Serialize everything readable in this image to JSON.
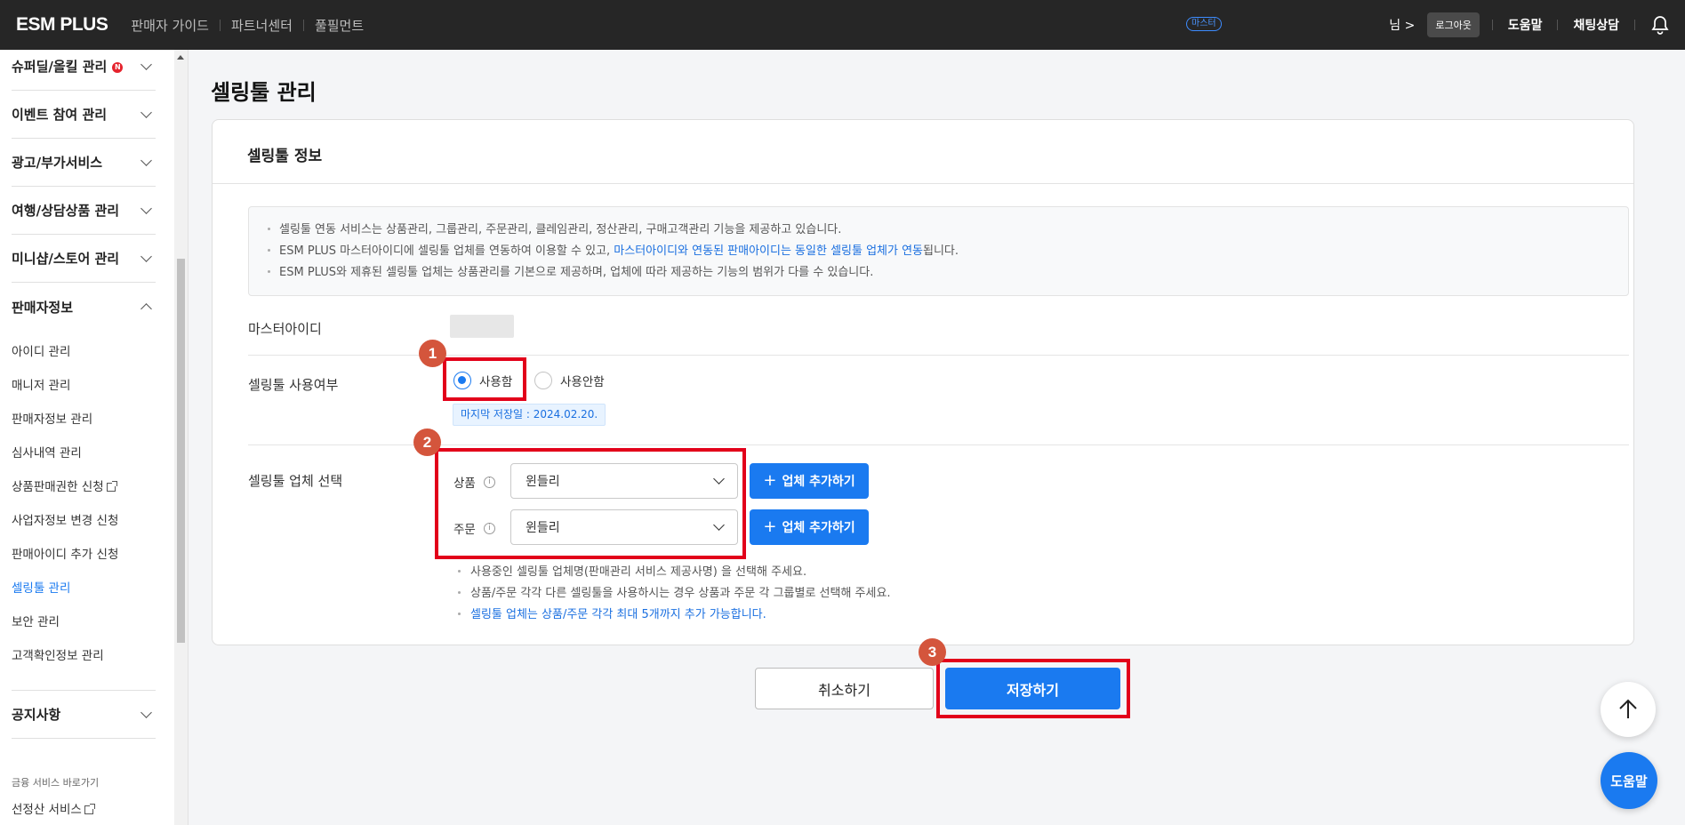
{
  "header": {
    "logo": "ESM PLUS",
    "nav": [
      "판매자 가이드",
      "파트너센터",
      "풀필먼트"
    ],
    "master_badge": "마스터",
    "user": "님 >",
    "logout": "로그아웃",
    "help": "도움말",
    "chat": "채팅상담",
    "bell_icon": "bell-icon"
  },
  "sidebar": {
    "groups_top": [
      {
        "label": "슈퍼딜/올킬 관리",
        "badge": "N"
      },
      {
        "label": "이벤트 참여 관리"
      },
      {
        "label": "광고/부가서비스"
      },
      {
        "label": "여행/상담상품 관리"
      },
      {
        "label": "미니샵/스토어 관리"
      }
    ],
    "open_group": "판매자정보",
    "items": [
      {
        "label": "아이디 관리"
      },
      {
        "label": "매니저 관리"
      },
      {
        "label": "판매자정보 관리"
      },
      {
        "label": "심사내역 관리"
      },
      {
        "label": "상품판매권한 신청"
      },
      {
        "label": "사업자정보 변경 신청"
      },
      {
        "label": "판매아이디 추가 신청"
      },
      {
        "label": "셀링툴 관리"
      },
      {
        "label": "보안 관리"
      },
      {
        "label": "고객확인정보 관리"
      }
    ],
    "notice_group": "공지사항",
    "finance_label": "금융 서비스 바로가기",
    "finance_item": "선정산 서비스"
  },
  "main": {
    "page_title": "셀링툴 관리",
    "card_title": "셀링툴 정보",
    "info": {
      "line1": "셀링툴 연동 서비스는 상품관리, 그룹관리, 주문관리, 클레임관리, 정산관리, 구매고객관리 기능을 제공하고 있습니다.",
      "line2_a": "ESM PLUS 마스터아이디에 셀링툴 업체를 연동하여 이용할 수 있고, ",
      "line2_b": "마스터아이디와 연동된 판매아이디는 동일한 셀링툴 업체가 연동",
      "line2_c": "됩니다.",
      "line3": "ESM PLUS와 제휴된 셀링툴 업체는 상품관리를 기본으로 제공하며, 업체에 따라 제공하는 기능의 범위가 다를 수 있습니다."
    },
    "master_id_label": "마스터아이디",
    "usage_label": "셀링툴 사용여부",
    "radio_use": "사용함",
    "radio_nouse": "사용안함",
    "radio_selected": "사용함",
    "last_saved": "마지막 저장일 : 2024.02.20.",
    "vendor_label": "셀링툴 업체 선택",
    "product_label": "상품",
    "order_label": "주문",
    "product_value": "윈들리",
    "order_value": "윈들리",
    "add_vendor": "업체 추가하기",
    "notes": {
      "n1": "사용중인 셀링툴 업체명(판매관리 서비스 제공사명) 을 선택해 주세요.",
      "n2": "상품/주문 각각 다른 셀링툴을 사용하시는 경우 상품과 주문 각 그룹별로 선택해 주세요.",
      "n3": "셀링툴 업체는 상품/주문 각각 최대 5개까지 추가 가능합니다."
    },
    "cancel": "취소하기",
    "save": "저장하기"
  },
  "annotations": {
    "m1": "1",
    "m2": "2",
    "m3": "3",
    "color": "#e2001a"
  },
  "fab": {
    "up_icon": "arrow-up-icon",
    "help": "도움말"
  },
  "colors": {
    "accent": "#1a7af0",
    "topbar": "#262626"
  }
}
